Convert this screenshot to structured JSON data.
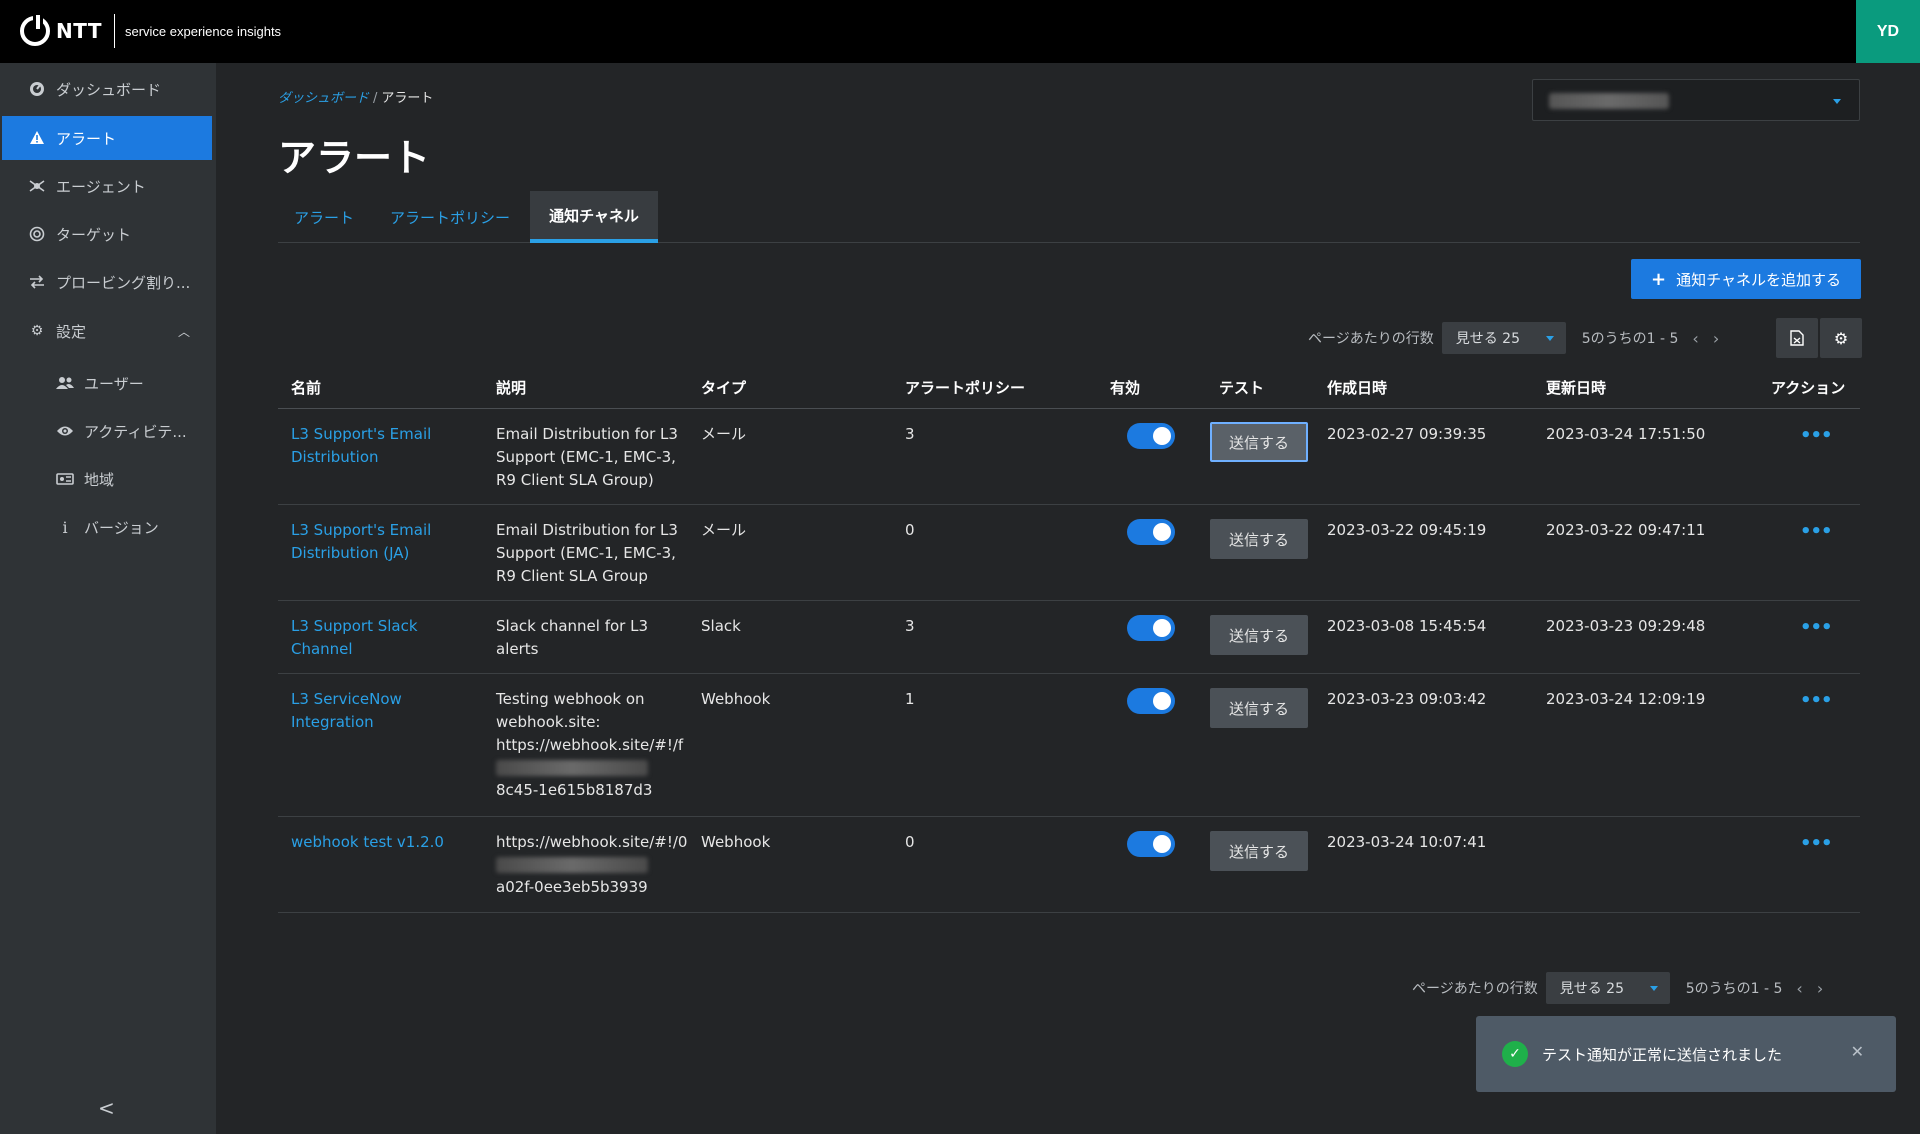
{
  "brand": {
    "logo": "NTT",
    "product": "service experience insights"
  },
  "user": {
    "initials": "YD"
  },
  "sidebar": {
    "items": [
      {
        "label": "ダッシュボード",
        "icon": "dashboard-icon"
      },
      {
        "label": "アラート",
        "icon": "warning-icon",
        "active": true
      },
      {
        "label": "エージェント",
        "icon": "agent-icon"
      },
      {
        "label": "ターゲット",
        "icon": "target-icon"
      },
      {
        "label": "プロービング割り...",
        "icon": "swap-icon"
      },
      {
        "label": "設定",
        "icon": "gear-icon"
      }
    ],
    "settings_children": [
      {
        "label": "ユーザー",
        "icon": "users-icon"
      },
      {
        "label": "アクティビテ...",
        "icon": "eye-icon"
      },
      {
        "label": "地域",
        "icon": "region-icon"
      },
      {
        "label": "バージョン",
        "icon": "info-icon"
      }
    ],
    "collapse": "<"
  },
  "breadcrumb": {
    "parent": "ダッシュボード",
    "separator": "/",
    "current": "アラート"
  },
  "page_title": "アラート",
  "tabs": [
    {
      "label": "アラート"
    },
    {
      "label": "アラートポリシー"
    },
    {
      "label": "通知チャネル",
      "active": true
    }
  ],
  "add_button": {
    "label": "通知チャネルを追加する"
  },
  "pager": {
    "rows_label": "ページあたりの行数",
    "rows_value": "見せる 25",
    "range": "5のうちの1 - 5"
  },
  "table": {
    "headers": [
      "名前",
      "説明",
      "タイプ",
      "アラートポリシー",
      "有効",
      "テスト",
      "作成日時",
      "更新日時",
      "アクション"
    ],
    "send_label": "送信する",
    "rows": [
      {
        "name": "L3 Support's Email Distribution",
        "desc": "Email Distribution for L3 Support (EMC-1, EMC-3, R9 Client SLA Group)",
        "type": "メール",
        "policies": "3",
        "created": "2023-02-27 09:39:35",
        "updated": "2023-03-24 17:51:50"
      },
      {
        "name": "L3 Support's Email Distribution (JA)",
        "desc": "Email Distribution for L3 Support (EMC-1, EMC-3, R9 Client SLA Group",
        "type": "メール",
        "policies": "0",
        "created": "2023-03-22 09:45:19",
        "updated": "2023-03-22 09:47:11"
      },
      {
        "name": "L3 Support Slack Channel",
        "desc": "Slack channel for L3 alerts",
        "type": "Slack",
        "policies": "3",
        "created": "2023-03-08 15:45:54",
        "updated": "2023-03-23 09:29:48"
      },
      {
        "name": "L3 ServiceNow Integration",
        "desc_a": "Testing webhook on webhook.site: https://webhook.site/#!/f",
        "desc_b": "8c45-1e615b8187d3",
        "type": "Webhook",
        "policies": "1",
        "created": "2023-03-23 09:03:42",
        "updated": "2023-03-24 12:09:19"
      },
      {
        "name": "webhook test v1.2.0",
        "desc_a": "https://webhook.site/#!/0",
        "desc_b": "a02f-0ee3eb5b3939",
        "type": "Webhook",
        "policies": "0",
        "created": "2023-03-24 10:07:41",
        "updated": ""
      }
    ]
  },
  "toast": {
    "message": "テスト通知が正常に送信されました"
  },
  "colors": {
    "accent": "#1c7ae0",
    "link": "#2aa0e6",
    "success": "#1fb04a",
    "avatar": "#0a9b7e"
  }
}
